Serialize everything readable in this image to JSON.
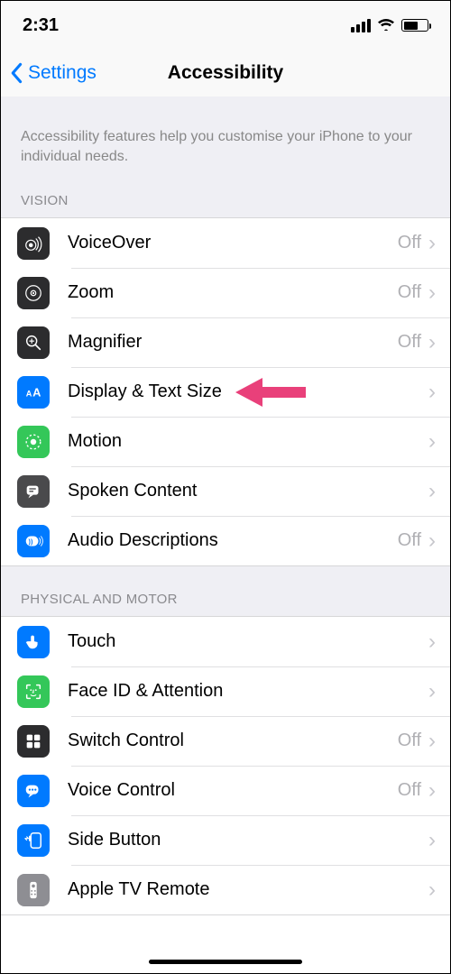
{
  "status": {
    "time": "2:31"
  },
  "nav": {
    "back": "Settings",
    "title": "Accessibility"
  },
  "intro": "Accessibility features help you customise your iPhone to your individual needs.",
  "sections": {
    "vision": {
      "header": "VISION",
      "items": [
        {
          "label": "VoiceOver",
          "value": "Off"
        },
        {
          "label": "Zoom",
          "value": "Off"
        },
        {
          "label": "Magnifier",
          "value": "Off"
        },
        {
          "label": "Display & Text Size",
          "value": ""
        },
        {
          "label": "Motion",
          "value": ""
        },
        {
          "label": "Spoken Content",
          "value": ""
        },
        {
          "label": "Audio Descriptions",
          "value": "Off"
        }
      ]
    },
    "physical": {
      "header": "PHYSICAL AND MOTOR",
      "items": [
        {
          "label": "Touch",
          "value": ""
        },
        {
          "label": "Face ID & Attention",
          "value": ""
        },
        {
          "label": "Switch Control",
          "value": "Off"
        },
        {
          "label": "Voice Control",
          "value": "Off"
        },
        {
          "label": "Side Button",
          "value": ""
        },
        {
          "label": "Apple TV Remote",
          "value": ""
        }
      ]
    }
  },
  "arrow_target": "Display & Text Size"
}
